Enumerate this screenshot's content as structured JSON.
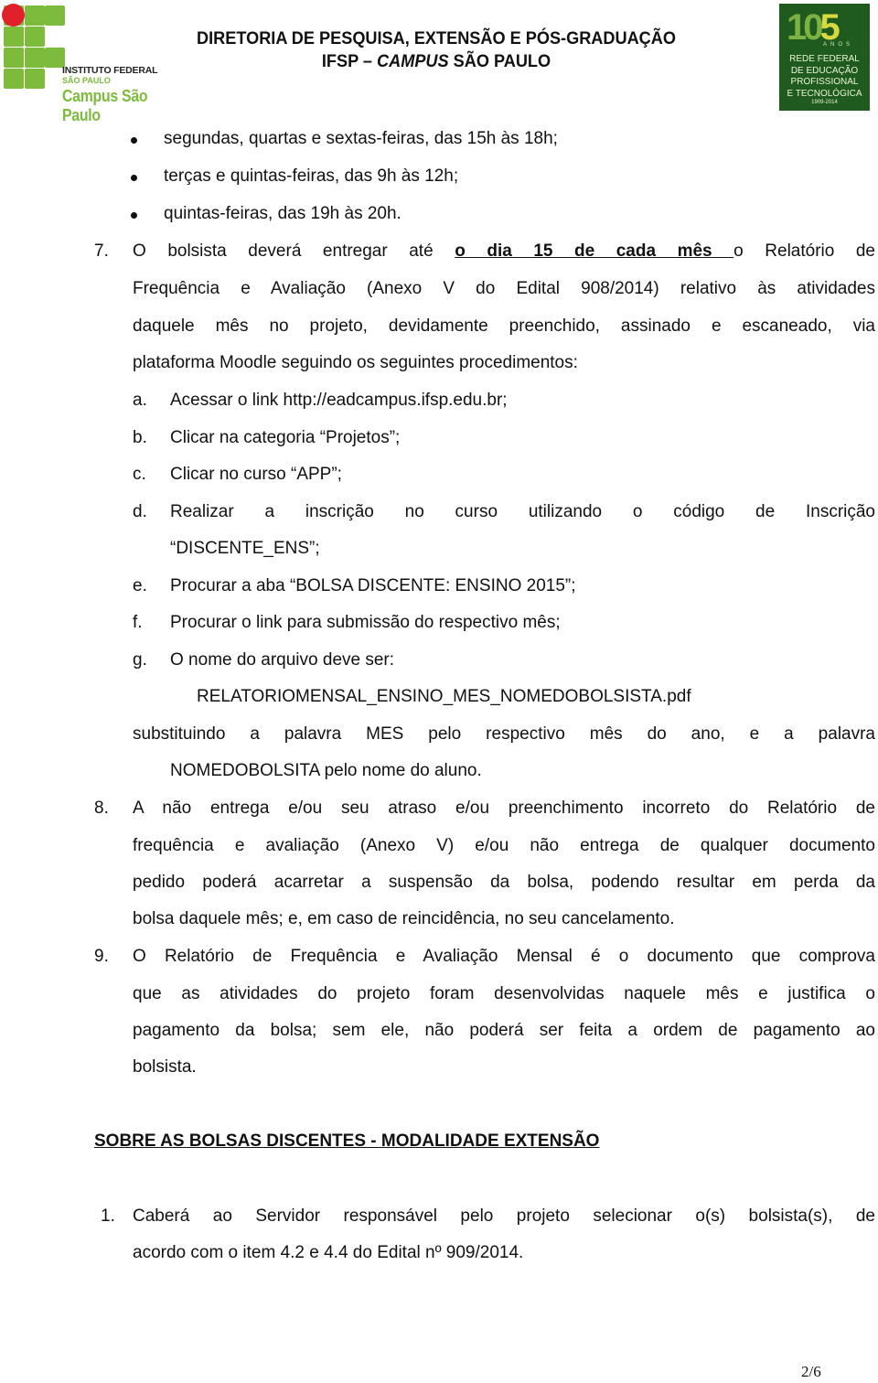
{
  "header": {
    "logo_left": {
      "institution": "INSTITUTO FEDERAL",
      "state": "SÃO PAULO",
      "campus": "Campus São Paulo",
      "colors": {
        "green": "#7dbb3c",
        "red": "#e0202a"
      }
    },
    "title_line1": "DIRETORIA DE PESQUISA, EXTENSÃO E PÓS-GRADUAÇÃO",
    "title_line2_prefix": "IFSP – ",
    "title_line2_italic": "CAMPUS",
    "title_line2_suffix": " SÃO PAULO",
    "badge": {
      "number_a": "10",
      "number_b": "5",
      "anos": "ANOS",
      "lines": [
        "REDE FEDERAL",
        "DE EDUCAÇÃO",
        "PROFISSIONAL",
        "E TECNOLÓGICA"
      ],
      "years": "1909-2014",
      "color": "#1f5b1f"
    }
  },
  "bullets": [
    "segundas, quartas e sextas-feiras, das 15h às 18h;",
    "terças e quintas-feiras, das 9h às 12h;",
    "quintas-feiras, das 19h às 20h."
  ],
  "item7": {
    "number": "7.",
    "line1_before": "O bolsista deverá entregar até ",
    "line1_bold": "o dia 15 de cada mês ",
    "line1_after": "o Relatório de",
    "lines": [
      "Frequência e Avaliação (Anexo V do Edital 908/2014) relativo às atividades",
      "daquele mês no projeto, devidamente preenchido, assinado e escaneado, via",
      "plataforma Moodle seguindo os seguintes procedimentos:"
    ],
    "steps": [
      {
        "letter": "a.",
        "text": "Acessar o link http://eadcampus.ifsp.edu.br;"
      },
      {
        "letter": "b.",
        "text": "Clicar na categoria “Projetos”;"
      },
      {
        "letter": "c.",
        "text": "Clicar no curso “APP”;"
      },
      {
        "letter": "d.",
        "text": "Realizar a inscrição no curso utilizando o código de Inscrição",
        "cont": "“DISCENTE_ENS”;"
      },
      {
        "letter": "e.",
        "text": "Procurar a aba “BOLSA DISCENTE: ENSINO 2015”;"
      },
      {
        "letter": "f.",
        "text": "Procurar o link para submissão do respectivo mês;"
      },
      {
        "letter": "g.",
        "text": "O nome do arquivo deve ser:"
      }
    ],
    "filename": "RELATORIOMENSAL_ENSINO_MES_NOMEDOBOLSISTA.pdf",
    "subst_line1": "substituindo a palavra MES pelo respectivo mês do ano, e a palavra",
    "subst_line2": "NOMEDOBOLSITA pelo nome do aluno."
  },
  "item8": {
    "number": "8.",
    "lines": [
      "A não entrega e/ou seu atraso e/ou preenchimento incorreto do Relatório de",
      "frequência e avaliação (Anexo V) e/ou não entrega de qualquer documento",
      "pedido poderá acarretar a suspensão da bolsa, podendo resultar em perda da",
      "bolsa daquele mês; e, em caso de reincidência, no seu cancelamento."
    ]
  },
  "item9": {
    "number": "9.",
    "lines": [
      "O Relatório de Frequência e Avaliação Mensal é o documento que comprova",
      "que as atividades do projeto foram desenvolvidas naquele mês e justifica o",
      "pagamento da bolsa; sem ele, não poderá ser feita a ordem de pagamento ao",
      "bolsista."
    ]
  },
  "section_heading": "SOBRE AS BOLSAS DISCENTES - MODALIDADE EXTENSÃO",
  "ext_item1": {
    "number": "1.",
    "lines": [
      "Caberá ao Servidor responsável pelo projeto selecionar o(s) bolsista(s), de",
      "acordo com o item 4.2 e 4.4 do Edital nº 909/2014."
    ]
  },
  "page_number": "2/6"
}
